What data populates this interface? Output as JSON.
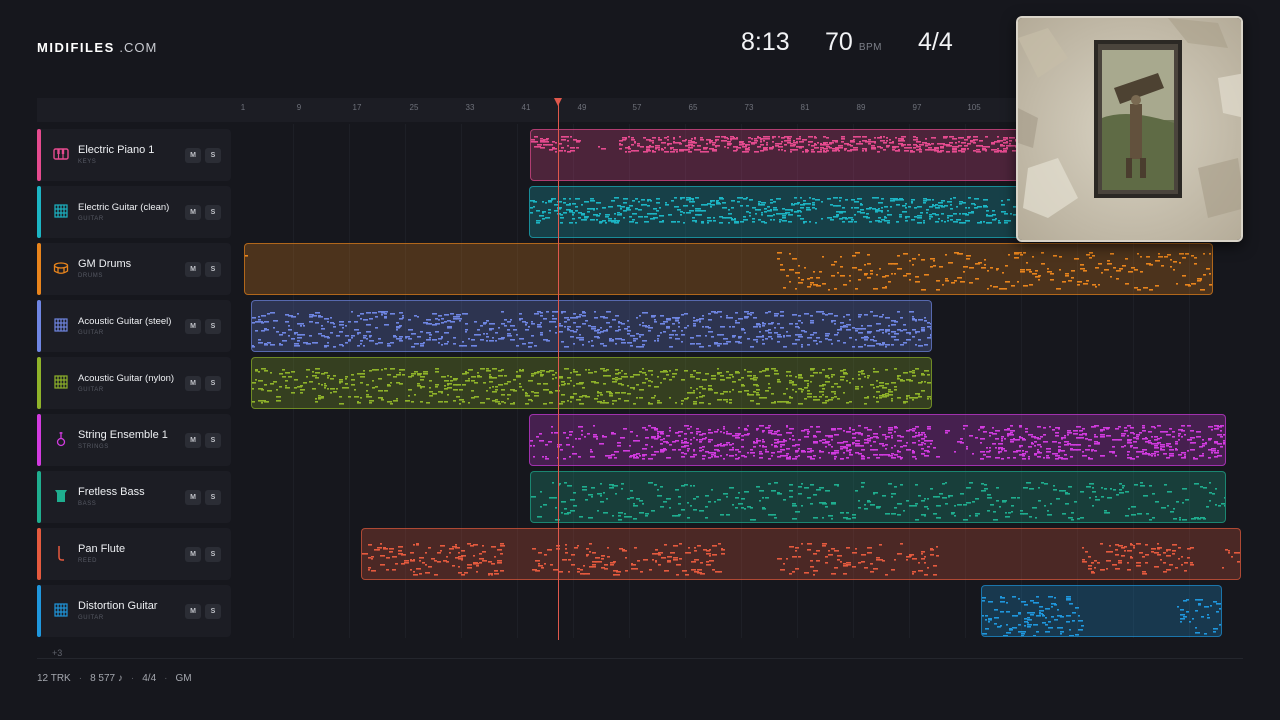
{
  "header": {
    "logo_bold": "MIDIFILES",
    "logo_light": " .COM",
    "time": "8:13",
    "tempo": "70",
    "tempo_unit": "BPM",
    "time_signature": "4/4"
  },
  "ruler": {
    "ticks": [
      "1",
      "9",
      "17",
      "25",
      "33",
      "41",
      "49",
      "57",
      "65",
      "73",
      "81",
      "89",
      "97",
      "105"
    ]
  },
  "tracks": [
    {
      "name": "Electric Piano 1",
      "category": "KEYS",
      "color": "#e64b8f",
      "icon": "piano-icon",
      "mute": "M",
      "solo": "S"
    },
    {
      "name": "Electric Guitar (clean)",
      "category": "GUITAR",
      "color": "#1cb5c4",
      "icon": "guitar-fretboard-icon",
      "mute": "M",
      "solo": "S"
    },
    {
      "name": "GM Drums",
      "category": "DRUMS",
      "color": "#e8841c",
      "icon": "drum-icon",
      "mute": "M",
      "solo": "S"
    },
    {
      "name": "Acoustic Guitar (steel)",
      "category": "GUITAR",
      "color": "#6f86e3",
      "icon": "guitar-fretboard-icon",
      "mute": "M",
      "solo": "S"
    },
    {
      "name": "Acoustic Guitar (nylon)",
      "category": "GUITAR",
      "color": "#8fb32a",
      "icon": "guitar-fretboard-icon",
      "mute": "M",
      "solo": "S"
    },
    {
      "name": "String Ensemble 1",
      "category": "STRINGS",
      "color": "#d23be0",
      "icon": "violin-icon",
      "mute": "M",
      "solo": "S"
    },
    {
      "name": "Fretless Bass",
      "category": "BASS",
      "color": "#1fae8f",
      "icon": "bass-icon",
      "mute": "M",
      "solo": "S"
    },
    {
      "name": "Pan Flute",
      "category": "REED",
      "color": "#e55a3e",
      "icon": "flute-icon",
      "mute": "M",
      "solo": "S"
    },
    {
      "name": "Distortion Guitar",
      "category": "GUITAR",
      "color": "#1f97dd",
      "icon": "guitar-fretboard-icon",
      "mute": "M",
      "solo": "S"
    }
  ],
  "more_tracks": "+3",
  "footer": {
    "tracks": "12 TRK",
    "notes": "8 577 ♪",
    "signature": "4/4",
    "standard": "GM"
  }
}
